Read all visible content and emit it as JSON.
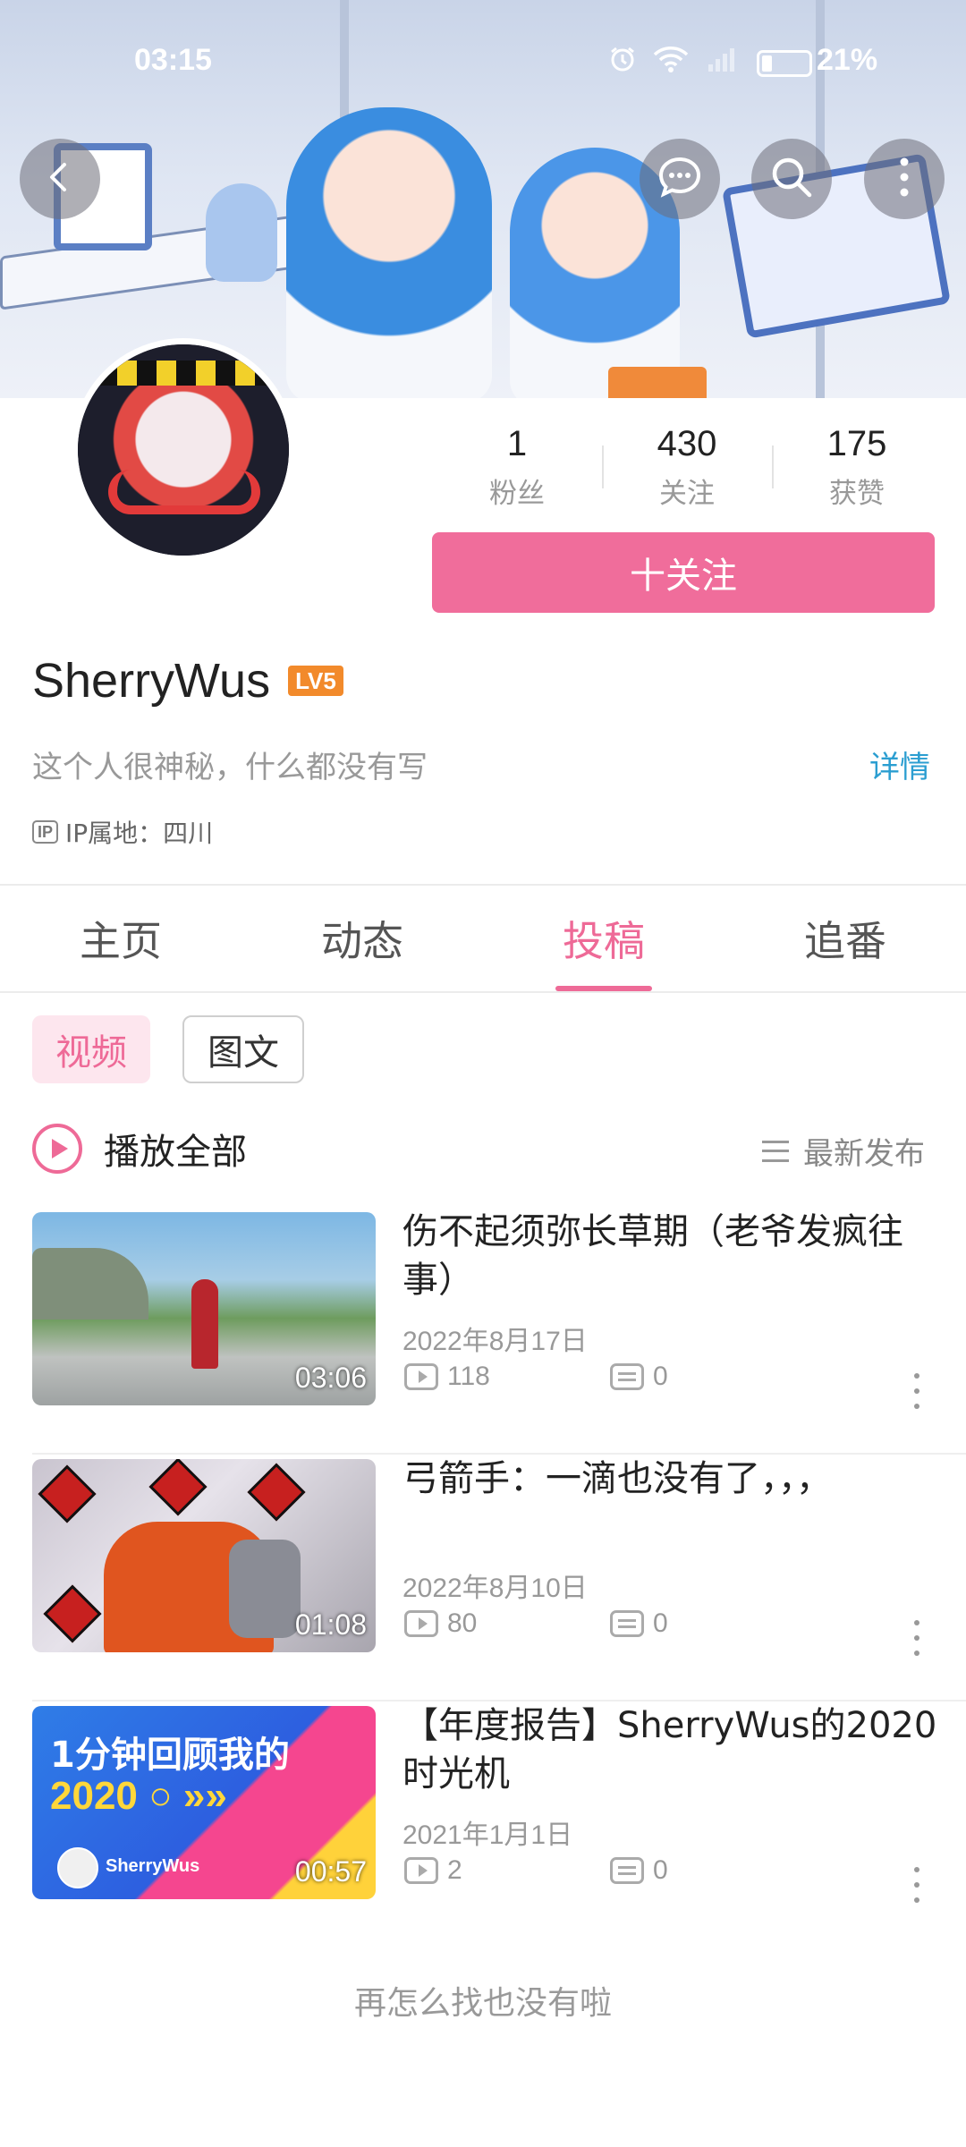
{
  "status_bar": {
    "time": "03:15",
    "battery": "21%"
  },
  "header": {
    "back_icon": "chevron-left-icon",
    "chat_icon": "chat-bubble-icon",
    "search_icon": "search-icon",
    "more_icon": "more-vertical-icon"
  },
  "profile": {
    "stats": [
      {
        "value": "1",
        "label": "粉丝"
      },
      {
        "value": "430",
        "label": "关注"
      },
      {
        "value": "175",
        "label": "获赞"
      }
    ],
    "follow_label": "十关注",
    "username": "SherryWus",
    "level": "LV5",
    "bio": "这个人很神秘，什么都没有写",
    "detail_link": "详情",
    "ip_tag": "IP",
    "ip_location": "IP属地：四川"
  },
  "tabs": [
    {
      "label": "主页",
      "active": false
    },
    {
      "label": "动态",
      "active": false
    },
    {
      "label": "投稿",
      "active": true
    },
    {
      "label": "追番",
      "active": false
    }
  ],
  "filters": {
    "video": "视频",
    "article": "图文"
  },
  "list_header": {
    "play_all": "播放全部",
    "sort": "最新发布"
  },
  "videos": [
    {
      "title": "伤不起须弥长草期（老爷发疯往事）",
      "date": "2022年8月17日",
      "views": "118",
      "danmaku": "0",
      "duration": "03:06"
    },
    {
      "title": "弓箭手：一滴也没有了，，，",
      "date": "2022年8月10日",
      "views": "80",
      "danmaku": "0",
      "duration": "01:08"
    },
    {
      "title": "【年度报告】SherryWus的2020时光机",
      "date": "2021年1月1日",
      "views": "2",
      "danmaku": "0",
      "duration": "00:57",
      "thumb_text_1": "1分钟回顾我的",
      "thumb_text_2": "2020 ○ »»",
      "thumb_user": "SherryWus"
    }
  ],
  "footer": {
    "end_text": "再怎么找也没有啦"
  },
  "colors": {
    "accent": "#ee6a97",
    "follow_button": "#f06d9b",
    "link": "#2b9ed1",
    "level_badge": "#f28a2b"
  }
}
